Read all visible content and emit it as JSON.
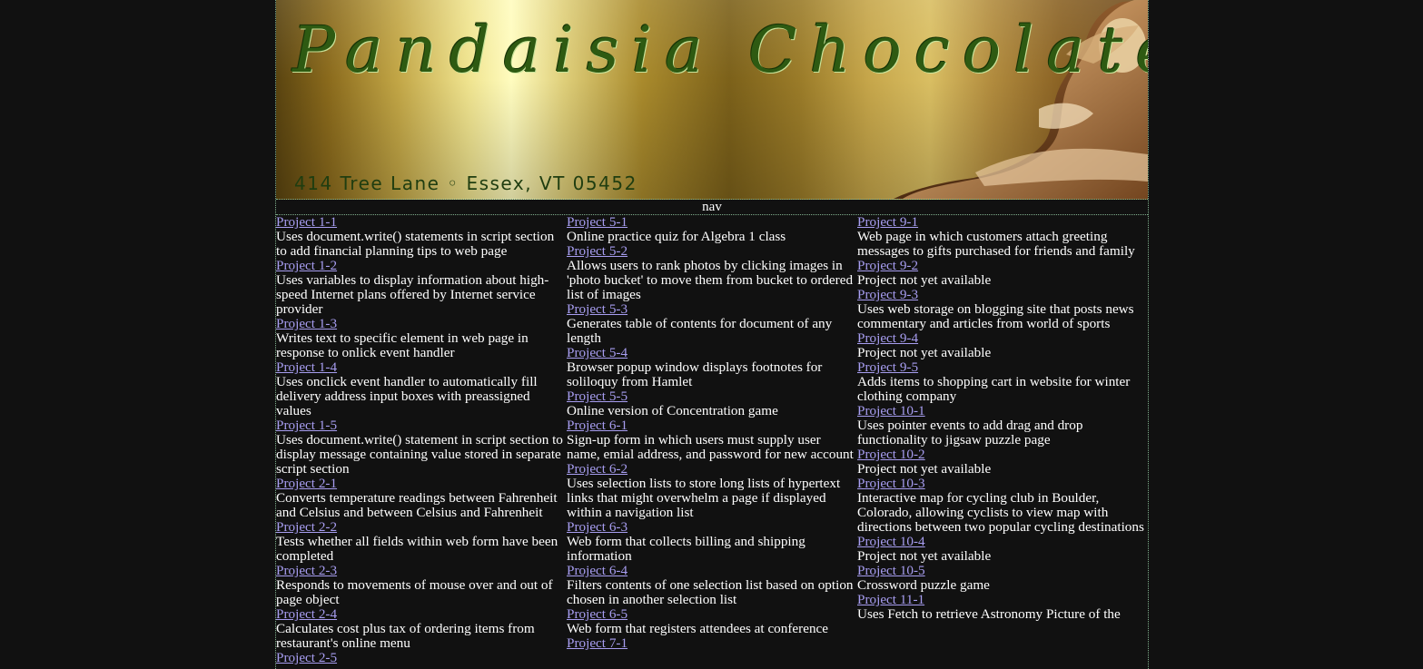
{
  "banner": {
    "title": "Pandaisia Chocolates",
    "address": "414 Tree Lane ◦ Essex, VT 05452"
  },
  "nav": {
    "label": "nav"
  },
  "columns": [
    [
      {
        "link": "Project 1-1",
        "desc": "Uses document.write() statements in script section to add financial planning tips to web page"
      },
      {
        "link": "Project 1-2",
        "desc": "Uses variables to display information about high-speed Internet plans offered by Internet service provider"
      },
      {
        "link": "Project 1-3",
        "desc": "Writes text to specific element in web page in response to onlick event handler"
      },
      {
        "link": "Project 1-4",
        "desc": "Uses onclick event handler to automatically fill delivery address input boxes with preassigned values"
      },
      {
        "link": "Project 1-5",
        "desc": "Uses document.write() statement in script section to display message containing value stored in separate script section"
      },
      {
        "link": "Project 2-1",
        "desc": "Converts temperature readings between Fahrenheit and Celsius and between Celsius and Fahrenheit"
      },
      {
        "link": "Project 2-2",
        "desc": "Tests whether all fields within web form have been completed"
      },
      {
        "link": "Project 2-3",
        "desc": "Responds to movements of mouse over and out of page object"
      },
      {
        "link": "Project 2-4",
        "desc": "Calculates cost plus tax of ordering items from restaurant's online menu"
      },
      {
        "link": "Project 2-5",
        "desc": ""
      }
    ],
    [
      {
        "link": "Project 5-1",
        "desc": "Online practice quiz for Algebra 1 class"
      },
      {
        "link": "Project 5-2",
        "desc": "Allows users to rank photos by clicking images in 'photo bucket' to move them from bucket to ordered list of images"
      },
      {
        "link": "Project 5-3",
        "desc": "Generates table of contents for document of any length"
      },
      {
        "link": "Project 5-4",
        "desc": "Browser popup window displays footnotes for soliloquy from Hamlet"
      },
      {
        "link": "Project 5-5",
        "desc": "Online version of Concentration game"
      },
      {
        "link": "Project 6-1",
        "desc": "Sign-up form in which users must supply user name, emial address, and password for new account"
      },
      {
        "link": "Project 6-2",
        "desc": "Uses selection lists to store long lists of hypertext links that might overwhelm a page if displayed within a navigation list"
      },
      {
        "link": "Project 6-3",
        "desc": "Web form that collects billing and shipping information"
      },
      {
        "link": "Project 6-4",
        "desc": "Filters contents of one selection list based on option chosen in another selection list"
      },
      {
        "link": "Project 6-5",
        "desc": "Web form that registers attendees at conference"
      },
      {
        "link": "Project 7-1",
        "desc": ""
      }
    ],
    [
      {
        "link": "Project 9-1",
        "desc": "Web page in which customers attach greeting messages to gifts purchased for friends and family"
      },
      {
        "link": "Project 9-2",
        "desc": "Project not yet available"
      },
      {
        "link": "Project 9-3",
        "desc": "Uses web storage on blogging site that posts news commentary and articles from world of sports"
      },
      {
        "link": "Project 9-4",
        "desc": "Project not yet available"
      },
      {
        "link": "Project 9-5",
        "desc": "Adds items to shopping cart in website for winter clothing company"
      },
      {
        "link": "Project 10-1",
        "desc": "Uses pointer events to add drag and drop functionality to jigsaw puzzle page"
      },
      {
        "link": "Project 10-2",
        "desc": "Project not yet available"
      },
      {
        "link": "Project 10-3",
        "desc": "Interactive map for cycling club in Boulder, Colorado, allowing cyclists to view map with directions between two popular cycling destinations"
      },
      {
        "link": "Project 10-4",
        "desc": "Project not yet available"
      },
      {
        "link": "Project 10-5",
        "desc": "Crossword puzzle game"
      },
      {
        "link": "Project 11-1",
        "desc": "Uses Fetch to retrieve Astronomy Picture of the"
      }
    ]
  ]
}
